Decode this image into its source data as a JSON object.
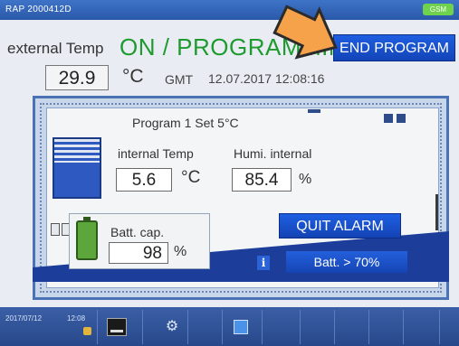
{
  "titlebar": {
    "app_id": "RAP 2000412D",
    "signal_label": "GSM"
  },
  "header": {
    "external_label": "external Temp",
    "status": "ON / PROGRAMMING",
    "end_button": "END PROGRAM",
    "external_value": "29.9",
    "external_unit": "°C",
    "gmt_label": "GMT",
    "datetime": "12.07.2017 12:08:16"
  },
  "container": {
    "program_title": "Program 1 Set 5°C",
    "internal_temp_label": "internal Temp",
    "internal_temp_value": "5.6",
    "internal_temp_unit": "°C",
    "humidity_label": "Humi. internal",
    "humidity_value": "85.4",
    "humidity_unit": "%"
  },
  "battery": {
    "label": "Batt. cap.",
    "value": "98",
    "unit": "%",
    "status": "Batt. > 70%",
    "info_glyph": "i"
  },
  "alarm": {
    "quit_button": "QUIT ALARM"
  },
  "taskbar": {
    "date": "2017/07/12",
    "time": "12:08",
    "gear_glyph": "⚙"
  },
  "colors": {
    "accent_blue": "#1e5ee0",
    "status_green": "#1e9b2e",
    "battery_green": "#5da63c",
    "arrow_orange": "#f5a24a"
  }
}
